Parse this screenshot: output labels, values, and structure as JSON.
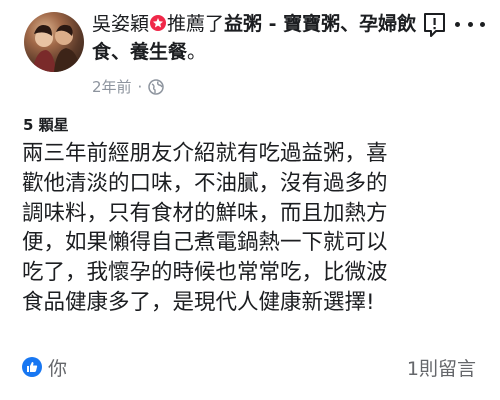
{
  "post": {
    "author": "吳姿穎",
    "action": "推薦了",
    "page": "益粥 - 寶寶粥、孕婦飲食、養生餐",
    "trailing": "。",
    "time": "2年前",
    "dot": "·"
  },
  "review": {
    "rating": "5 顆星",
    "lines": [
      "兩三年前經朋友介紹就有吃過益粥，喜",
      "歡他清淡的口味，不油膩，沒有過多的",
      "調味料，只有食材的鮮味，而且加熱方",
      "便，如果懶得自己煮電鍋熱一下就可以",
      "吃了，我懷孕的時候也常常吃，比微波",
      "食品健康多了，是現代人健康新選擇!"
    ]
  },
  "footer": {
    "likers": "你",
    "comments": "1則留言"
  },
  "icons": {
    "recommend": "recommend-star-icon",
    "privacy": "globe-icon",
    "report": "report-flag-icon",
    "more": "more-options-icon",
    "like": "thumbs-up-icon"
  },
  "colors": {
    "recommend": "#f02849",
    "like": "#1877f2",
    "meta": "#8d949e",
    "text": "#1c1e21"
  }
}
